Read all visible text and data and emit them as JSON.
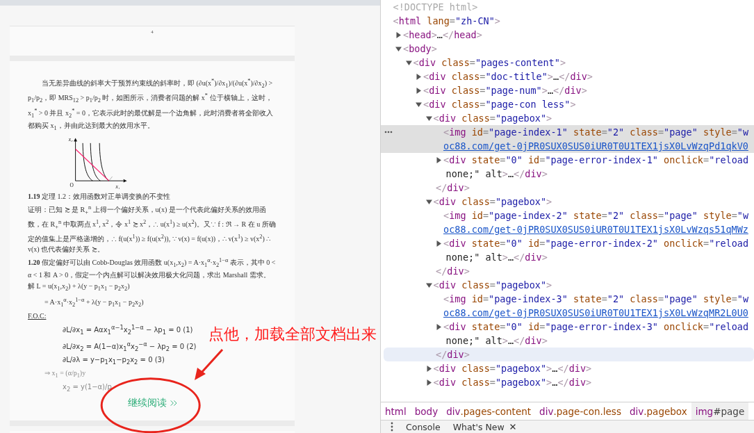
{
  "document": {
    "page_number": "4",
    "intro": "当无差异曲线的斜率大于预算约束线的斜率时，即 (∂u(x$^{*}$)/∂x$_{1}$)/(∂u(x$^{*}$)/∂x$_{2}$) > p$_{1}$/p$_{2}$，即 MRS$_{12}$ > p$_{1}$/p$_{2}$ 时，如图所示，消费者问题的解 x$^{*}$ 位于横轴上，这时，x$_{1}$$^{*}$ > 0 并且 x$_{2}$$^{*}$ = 0，它表示此时的最优解是一个边角解，此时消费者将全部收入都购买 x$_{1}$，并由此达到最大的效用水平。",
    "figure": {
      "y_axis": "x₂",
      "origin": "O",
      "x_axis": "x₁"
    },
    "blocks": [
      {
        "kind": "paragraph",
        "faded": false,
        "text": "**1.19** 定理 1.2：效用函数对正单调变换的不变性"
      },
      {
        "kind": "paragraph",
        "faded": false,
        "text": "证明：已知 ≿ 是 R$_{+}$$^{n}$ 上得一个偏好关系，u(x) 是一个代表此偏好关系的效用函数，在 R$_{+}$$^{n}$ 中取两点 x$^{1}$, x$^{2}$，令 x$^{1}$ ≿ x$^{2}$，∴ u(x$^{1}$) ≥ u(x$^{2}$)。又∵ f : ℜ → R 在 u 所确定的值集上是严格递增的，∴ f(u(x$^{1}$)) ≥ f(u(x$^{2}$)), ∵ v(x) = f(u(x))，∴ v(x$^{1}$) ≥ v(x$^{2}$) ∴ v(x) 也代表偏好关系 ≿。"
      },
      {
        "kind": "paragraph",
        "faded": false,
        "text": "**1.20** 假定偏好可以由 Cobb-Douglas 效用函数 u(x$_{1}$,x$_{2}$) = A·x$_{1}$$^{α}$·x$_{2}$$^{1−α}$ 表示，其中 0 < α < 1 和 A > 0，假定一个内点解可以解决效用极大化问题，求出 Marshall 需求。"
      },
      {
        "kind": "formula",
        "faded": false,
        "text": "解  L = u(x$_{1}$,x$_{2}$) + λ(y − p$_{1}$x$_{1}$ − p$_{2}$x$_{2}$)"
      },
      {
        "kind": "continued",
        "faded": false,
        "text": "= A·x$_{1}$$^{α}$·x$_{2}$$^{1−α}$ + λ(y − p$_{1}$x$_{1}$ − p$_{2}$x$_{2}$)"
      },
      {
        "kind": "label",
        "faded": false,
        "text": "F.O.C:"
      },
      {
        "kind": "system",
        "faded": false,
        "text": "∂L/∂x$_{1}$ = Aαx$_{1}$$^{α−1}$x$_{2}$$^{1−α}$ − λp$_{1}$ = 0   (1)"
      },
      {
        "kind": "system",
        "faded": false,
        "text": "∂L/∂x$_{2}$ = A(1−α)x$_{1}$$^{α}$x$_{2}$$^{−α}$ − λp$_{2}$ = 0   (2)"
      },
      {
        "kind": "system",
        "faded": false,
        "text": "∂L/∂λ = y−p$_{1}$x$_{1}$−p$_{2}$x$_{2}$ = 0   (3)"
      },
      {
        "kind": "continued",
        "faded": true,
        "text": "⇒ x$_{1}$ = (α/p$_{1}$)y"
      },
      {
        "kind": "system",
        "faded": true,
        "text": "x$_{2}$ = y(1−α)/p"
      }
    ],
    "continue_button": "继续阅读"
  },
  "annotation": {
    "text": "点他，加载全部文档出来"
  },
  "dom_tree": [
    {
      "kind": "doctype",
      "selected": false,
      "text": "<!DOCTYPE html>"
    },
    {
      "kind": "root",
      "selected": false,
      "text": "<html lang=\"zh-CN\">",
      "children": [
        {
          "kind": "branch",
          "expanded": false,
          "selected": false,
          "text": "<head>…</head>"
        },
        {
          "kind": "branch",
          "expanded": true,
          "selected": false,
          "text": "<body>",
          "children": [
            {
              "kind": "branch",
              "expanded": true,
              "selected": false,
              "text": "<div class=\"pages-content\">",
              "children": [
                {
                  "kind": "branch",
                  "expanded": false,
                  "selected": false,
                  "text": "<div class=\"doc-title\">…</div>"
                },
                {
                  "kind": "branch",
                  "expanded": false,
                  "selected": false,
                  "text": "<div class=\"page-num\">…</div>"
                },
                {
                  "kind": "branch",
                  "expanded": true,
                  "selected": false,
                  "text": "<div class=\"page-con less\">",
                  "children": [
                    {
                      "kind": "branch",
                      "expanded": true,
                      "selected": false,
                      "text": "<div class=\"pagebox\">",
                      "close": {
                        "text": "</div>",
                        "hovered": false
                      },
                      "children": [
                        {
                          "kind": "leaf",
                          "selected": true,
                          "text": "<img id=\"page-index-1\" state=\"2\" class=\"page\" style=\"w",
                          "link": "oc88.com/get-0jPR0SUX0SUS0iUR0T0U1TEX1jsX0LvWzqPd1qkV0"
                        },
                        {
                          "kind": "branch",
                          "expanded": false,
                          "selected": false,
                          "text": "<div state=\"0\" id=\"page-error-index-1\" onclick=\"reload",
                          "wrap": "none;\" alt>…</div>"
                        }
                      ]
                    },
                    {
                      "kind": "branch",
                      "expanded": true,
                      "selected": false,
                      "text": "<div class=\"pagebox\">",
                      "close": {
                        "text": "</div>",
                        "hovered": false
                      },
                      "children": [
                        {
                          "kind": "leaf",
                          "selected": false,
                          "text": "<img id=\"page-index-2\" state=\"2\" class=\"page\" style=\"w",
                          "link": "oc88.com/get-0jPR0SUX0SUS0iUR0T0U1TEX1jsX0LvWzqs51qMWz"
                        },
                        {
                          "kind": "branch",
                          "expanded": false,
                          "selected": false,
                          "text": "<div state=\"0\" id=\"page-error-index-2\" onclick=\"reload",
                          "wrap": "none;\" alt>…</div>"
                        }
                      ]
                    },
                    {
                      "kind": "branch",
                      "expanded": true,
                      "selected": false,
                      "text": "<div class=\"pagebox\">",
                      "close": {
                        "text": "</div>",
                        "hovered": true
                      },
                      "children": [
                        {
                          "kind": "leaf",
                          "selected": false,
                          "text": "<img id=\"page-index-3\" state=\"2\" class=\"page\" style=\"w",
                          "link": "oc88.com/get-0jPR0SUX0SUS0iUR0T0U1TEX1jsX0LvWzqMR2L0U0"
                        },
                        {
                          "kind": "branch",
                          "expanded": false,
                          "selected": false,
                          "text": "<div state=\"0\" id=\"page-error-index-3\" onclick=\"reload",
                          "wrap": "none;\" alt>…</div>"
                        }
                      ]
                    },
                    {
                      "kind": "branch",
                      "expanded": false,
                      "selected": false,
                      "text": "<div class=\"pagebox\">…</div>"
                    },
                    {
                      "kind": "branch",
                      "expanded": false,
                      "selected": false,
                      "text": "<div class=\"pagebox\">…</div>"
                    }
                  ]
                }
              ]
            }
          ]
        }
      ]
    }
  ],
  "breadcrumbs": [
    {
      "label": "html",
      "selected": false
    },
    {
      "label": "body",
      "selected": false
    },
    {
      "label": "div.pages-content",
      "selected": false
    },
    {
      "label": "div.page-con.less",
      "selected": false
    },
    {
      "label": "div.pagebox",
      "selected": false
    },
    {
      "label": "img#page",
      "selected": true
    }
  ],
  "drawer_tabs": [
    {
      "label": "Console",
      "selected": false,
      "closable": false
    },
    {
      "label": "What's New",
      "selected": false,
      "closable": true
    }
  ]
}
